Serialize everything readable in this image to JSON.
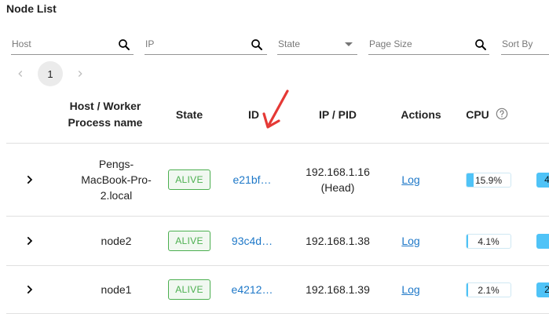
{
  "page": {
    "title": "Node List"
  },
  "filters": {
    "host": {
      "placeholder": "Host"
    },
    "ip": {
      "placeholder": "IP"
    },
    "state": {
      "placeholder": "State"
    },
    "page_size": {
      "placeholder": "Page Size"
    },
    "sort_by": {
      "placeholder": "Sort By"
    }
  },
  "pagination": {
    "current_page": "1",
    "prev_icon": "chevron-left-icon",
    "next_icon": "chevron-right-icon"
  },
  "table": {
    "headers": {
      "host_line1": "Host / Worker",
      "host_line2": "Process name",
      "state": "State",
      "id": "ID",
      "ip_pid": "IP / PID",
      "actions": "Actions",
      "cpu": "CPU"
    },
    "rows": [
      {
        "host_lines": [
          "Pengs-",
          "MacBook-Pro-",
          "2.local"
        ],
        "state": "ALIVE",
        "id": "e21bf…",
        "ip": "192.168.1.16",
        "ip_sub": "(Head)",
        "action": "Log",
        "cpu_label": "15.9%",
        "cpu": 15.9,
        "mem_label": "4"
      },
      {
        "host_lines": [
          "node2"
        ],
        "state": "ALIVE",
        "id": "93c4d…",
        "ip": "192.168.1.38",
        "ip_sub": "",
        "action": "Log",
        "cpu_label": "4.1%",
        "cpu": 4.1,
        "mem_label": ""
      },
      {
        "host_lines": [
          "node1"
        ],
        "state": "ALIVE",
        "id": "e4212…",
        "ip": "192.168.1.39",
        "ip_sub": "",
        "action": "Log",
        "cpu_label": "2.1%",
        "cpu": 2.1,
        "mem_label": "2"
      }
    ]
  },
  "colors": {
    "link": "#1e78c8",
    "alive": "#4caf50",
    "bar": "#4fc3f7",
    "annotation_arrow": "#e53935"
  },
  "icons": {
    "search": "search-icon",
    "dropdown": "caret-down-icon",
    "expand": "chevron-right-icon",
    "help": "help-circle-icon",
    "annotation": "red-arrow-icon"
  }
}
